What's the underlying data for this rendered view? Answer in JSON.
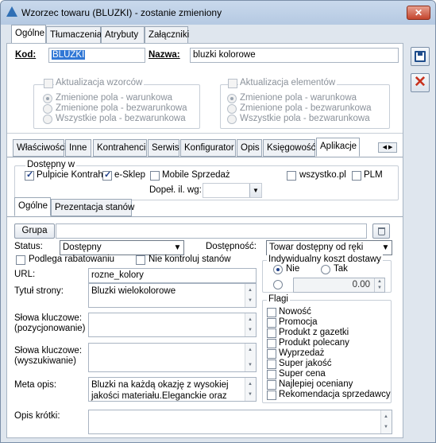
{
  "window": {
    "title": "Wzorzec towaru (BLUZKI) - zostanie zmieniony",
    "close": "✕"
  },
  "top_tabs": [
    "Ogólne",
    "Tłumaczenia",
    "Atrybuty",
    "Załączniki"
  ],
  "kod": {
    "label": "Kod:",
    "value": "BLUZKI"
  },
  "nazwa": {
    "label": "Nazwa:",
    "value": "bluzki kolorowe"
  },
  "akt_wzorcow": {
    "label": "Aktualizacja wzorców",
    "options": [
      "Zmienione pola - warunkowa",
      "Zmienione pola - bezwarunkowa",
      "Wszystkie pola - bezwarunkowa"
    ]
  },
  "akt_elementow": {
    "label": "Aktualizacja elementów",
    "options": [
      "Zmienione pola - warunkowa",
      "Zmienione pola - bezwarunkowa",
      "Wszystkie pola - bezwarunkowa"
    ]
  },
  "sub_tabs": [
    "Właściwości",
    "Inne",
    "Kontrahenci",
    "Serwis",
    "Konfigurator",
    "Opis",
    "Księgowość",
    "Aplikacje"
  ],
  "dostepny_w": {
    "label": "Dostępny w",
    "pulpit": "Pulpicie Kontrah",
    "esklep": "e-Sklep",
    "mobile": "Mobile Sprzedaż",
    "wszystko": "wszystko.pl",
    "plm": "PLM",
    "dopel_label": "Dopeł. il. wg:",
    "dopel_value": ""
  },
  "inner_tabs": [
    "Ogólne",
    "Prezentacja stanów"
  ],
  "grupa": {
    "button": "Grupa",
    "value": ""
  },
  "status": {
    "label": "Status:",
    "value": "Dostępny"
  },
  "dostepnosc": {
    "label": "Dostępność:",
    "value": "Towar dostępny od ręki"
  },
  "podlega": "Podlega rabatowaniu",
  "nie_kontroluj": "Nie kontroluj stanów",
  "koszt": {
    "label": "Indywidualny koszt dostawy",
    "nie": "Nie",
    "tak": "Tak",
    "value": "0.00"
  },
  "url": {
    "label": "URL:",
    "value": "rozne_kolory"
  },
  "tytul": {
    "label": "Tytuł strony:",
    "value": "Bluzki wielokolorowe"
  },
  "slowa_poz": {
    "label1": "Słowa kluczowe:",
    "label2": "(pozycjonowanie)",
    "value": ""
  },
  "slowa_wysz": {
    "label1": "Słowa kluczowe:",
    "label2": "(wyszukiwanie)",
    "value": ""
  },
  "meta": {
    "label": "Meta opis:",
    "line1": "Bluzki na każdą okazję z wysokiej",
    "line2": "jakości materiału.Eleganckie oraz"
  },
  "opis_krotki": {
    "label": "Opis krótki:",
    "value": ""
  },
  "flagi": {
    "label": "Flagi",
    "items": [
      "Nowość",
      "Promocja",
      "Produkt z gazetki",
      "Produkt polecany",
      "Wyprzedaż",
      "Super jakość",
      "Super cena",
      "Najlepiej oceniany",
      "Rekomendacja sprzedawcy"
    ]
  },
  "colors": {
    "accent": "#2f6fb5",
    "close": "#c4452d",
    "titlebar": "#b5c9e2",
    "window_bg": "#dfe6ee"
  }
}
